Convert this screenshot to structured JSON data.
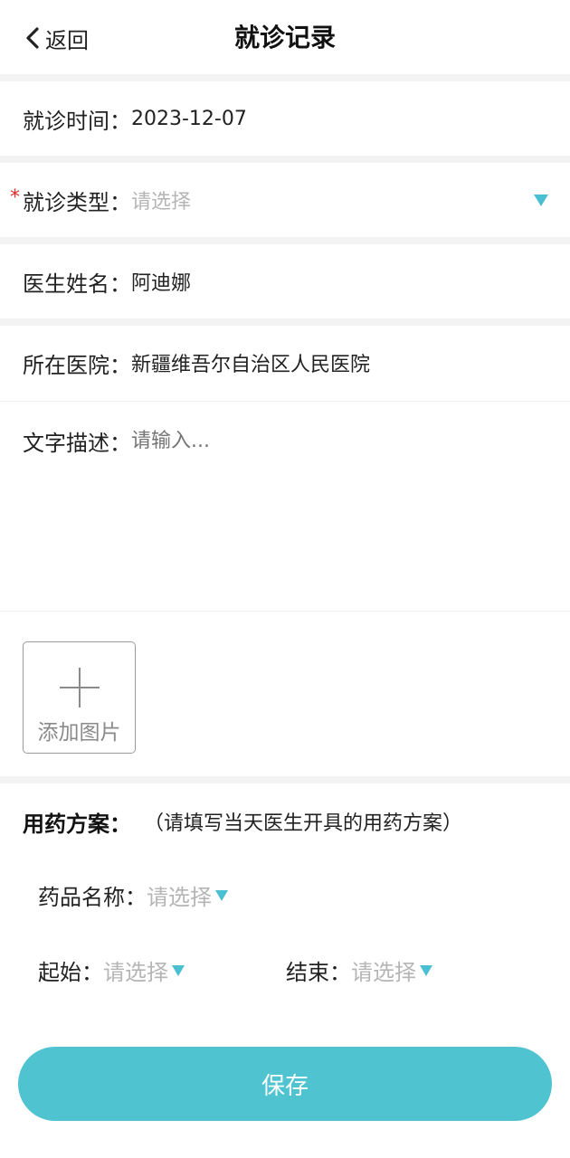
{
  "header": {
    "back_label": "返回",
    "title": "就诊记录"
  },
  "visit_time": {
    "label": "就诊时间：",
    "value": "2023-12-07"
  },
  "visit_type": {
    "required_mark": "*",
    "label": "就诊类型：",
    "placeholder": "请选择"
  },
  "doctor_name": {
    "label": "医生姓名：",
    "value": "阿迪娜"
  },
  "hospital": {
    "label": "所在医院：",
    "value": "新疆维吾尔自治区人民医院"
  },
  "description": {
    "label": "文字描述：",
    "placeholder": "请输入..."
  },
  "add_image": {
    "label": "添加图片"
  },
  "medication_plan": {
    "title": "用药方案：",
    "hint": "（请填写当天医生开具的用药方案）",
    "drug_name": {
      "label": "药品名称：",
      "placeholder": "请选择"
    },
    "start": {
      "label": "起始：",
      "placeholder": "请选择"
    },
    "end": {
      "label": "结束：",
      "placeholder": "请选择"
    }
  },
  "save_label": "保存",
  "colors": {
    "accent": "#4fc3d0",
    "dropdown_triangle": "#4bbfd2",
    "required": "#e02a2a",
    "placeholder": "#b5b5b5"
  }
}
